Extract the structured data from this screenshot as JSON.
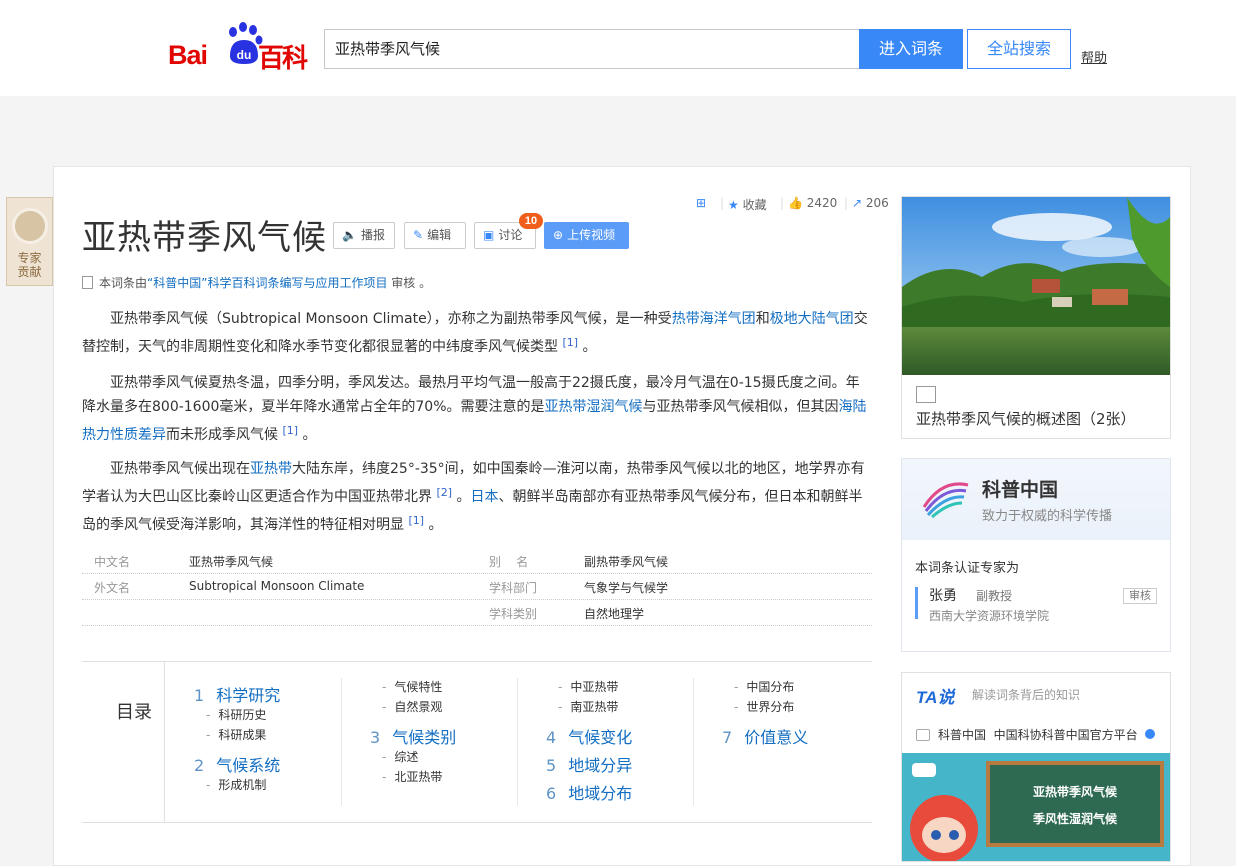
{
  "header": {
    "logo_bai": "Bai",
    "logo_du": "du",
    "logo_baike": "百科",
    "search_value": "亚热带季风气候",
    "enter_label": "进入词条",
    "all_search_label": "全站搜索",
    "help_label": "帮助"
  },
  "side_tab": {
    "label_line1": "专家",
    "label_line2": "贡献"
  },
  "tools": {
    "collect": "收藏",
    "likes": "2420",
    "shares": "206"
  },
  "entry": {
    "title": "亚热带季风气候",
    "buttons": {
      "play": "播报",
      "edit": "编辑",
      "discuss": "讨论",
      "discuss_count": "10",
      "upload": "上传视频"
    },
    "review": {
      "prefix": "本词条由",
      "link": "“科普中国”科学百科词条编写与应用工作项目",
      "suffix": " 审核 。"
    }
  },
  "paragraphs": {
    "p1": {
      "t1": "亚热带季风气候（Subtropical Monsoon Climate），亦称之为副热带季风气候，是一种受",
      "l1": "热带海洋气团",
      "t2": "和",
      "l2": "极地大陆气团",
      "t3": "交替控制，天气的非周期性变化和降水季节变化都很显著的中纬度季风气候类型 ",
      "ref": "[1]",
      "t4": " 。"
    },
    "p2": {
      "t1": "亚热带季风气候夏热冬温，四季分明，季风发达。最热月平均气温一般高于22摄氏度，最冷月气温在0-15摄氏度之间。年降水量多在800-1600毫米，夏半年降水通常占全年的70%。需要注意的是",
      "l1": "亚热带湿润气候",
      "t2": "与亚热带季风气候相似，但其因",
      "l2": "海陆热力性质差异",
      "t3": "而未形成季风气候 ",
      "ref": "[1]",
      "t4": " 。"
    },
    "p3": {
      "t1": "亚热带季风气候出现在",
      "l1": "亚热带",
      "t2": "大陆东岸，纬度25°-35°间，如中国秦岭—淮河以南，热带季风气候以北的地区，地学界亦有学者认为大巴山区比秦岭山区更适合作为中国亚热带北界 ",
      "ref1": "[2]",
      "t3": " 。",
      "l2": "日本",
      "t4": "、朝鲜半岛南部亦有亚热带季风气候分布，但日本和朝鲜半岛的季风气候受海洋影响，其海洋性的特征相对明显 ",
      "ref2": "[1]",
      "t5": " 。"
    }
  },
  "basic_info": {
    "rows": [
      {
        "k1": "中文名",
        "v1": "亚热带季风气候",
        "k2": "别    名",
        "v2": "副热带季风气候"
      },
      {
        "k1": "外文名",
        "v1": "Subtropical Monsoon Climate",
        "k2": "学科部门",
        "v2": "气象学与气候学"
      },
      {
        "k1": "",
        "v1": "",
        "k2": "学科类别",
        "v2": "自然地理学"
      }
    ]
  },
  "catalog": {
    "heading": "目录",
    "s1": {
      "num": "1",
      "title": "科学研究",
      "sub1": "科研历史",
      "sub2": "科研成果"
    },
    "s2": {
      "num": "2",
      "title": "气候系统",
      "sub1": "形成机制",
      "sub2": "气候特性",
      "sub3": "自然景观"
    },
    "s3": {
      "num": "3",
      "title": "气候类别",
      "sub1": "综述",
      "sub2": "北亚热带",
      "sub3": "中亚热带",
      "sub4": "南亚热带"
    },
    "s4": {
      "num": "4",
      "title": "气候变化"
    },
    "s5": {
      "num": "5",
      "title": "地域分异",
      "sub1": "中国分布",
      "sub2": "世界分布"
    },
    "s6": {
      "num": "6",
      "title": "地域分布"
    },
    "s7": {
      "num": "7",
      "title": "价值意义"
    }
  },
  "album": {
    "caption": "亚热带季风气候的概述图（2张）"
  },
  "kepu": {
    "name": "科普中国",
    "slogan": "致力于权威的科学传播",
    "cert_label": "本词条认证专家为",
    "expert_name": "张勇",
    "expert_title": "副教授",
    "expert_org": "西南大学资源环境学院",
    "role": "审核"
  },
  "tashuo": {
    "logo": "TA说",
    "subtitle": "解读词条背后的知识",
    "source": "科普中国",
    "source_desc": "中国科协科普中国官方平台",
    "video_line1": "亚热带季风气候",
    "video_line2": "季风性湿润气候"
  }
}
